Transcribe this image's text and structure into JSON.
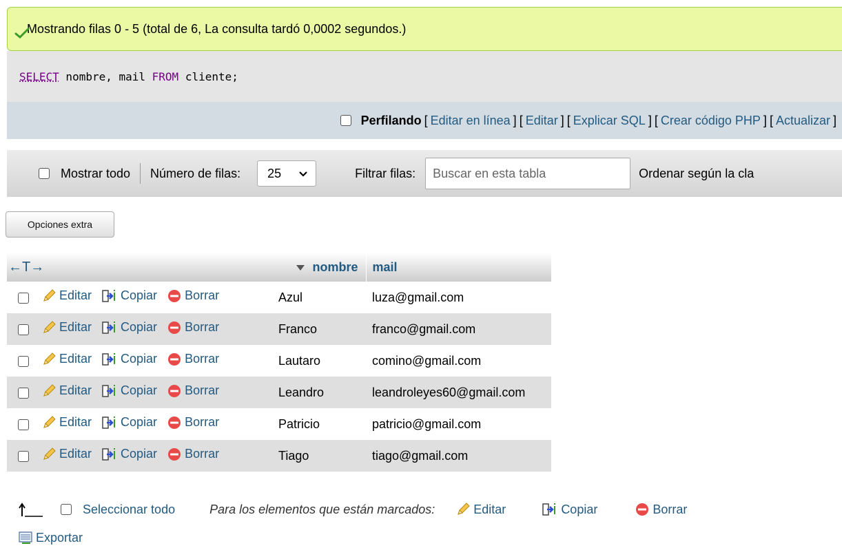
{
  "status": {
    "message": "Mostrando filas 0 - 5 (total de 6, La consulta tardó 0,0002 segundos.)"
  },
  "sql": {
    "select_kw": "SELECT",
    "part1": " nombre, mail ",
    "from_kw": "FROM",
    "part2": " cliente;"
  },
  "tools": {
    "profiling": "Perfilando",
    "open1": "[",
    "edit_inline": "Editar en línea",
    "close1": "]",
    "open2": "[",
    "edit": "Editar",
    "close2": "]",
    "open3": "[",
    "explain": "Explicar SQL",
    "close3": "]",
    "open4": "[",
    "php": "Crear código PHP",
    "close4": "]",
    "open5": "[",
    "refresh": "Actualizar",
    "close5": "]"
  },
  "nav": {
    "show_all": "Mostrar todo",
    "rows_label": "Número de filas:",
    "rows_value": "25",
    "filter_label": "Filtrar filas:",
    "search_placeholder": "Buscar en esta tabla",
    "sort_label": "Ordenar según la cla"
  },
  "extra_options": "Opciones extra",
  "table": {
    "resize_arrows": "←T→",
    "col_nombre": "nombre",
    "col_mail": "mail",
    "action_edit": "Editar",
    "action_copy": "Copiar",
    "action_delete": "Borrar",
    "rows": [
      {
        "nombre": "Azul",
        "mail": "luza@gmail.com"
      },
      {
        "nombre": "Franco",
        "mail": "franco@gmail.com"
      },
      {
        "nombre": "Lautaro",
        "mail": "comino@gmail.com"
      },
      {
        "nombre": "Leandro",
        "mail": "leandroleyes60@gmail.com"
      },
      {
        "nombre": "Patricio",
        "mail": "patricio@gmail.com"
      },
      {
        "nombre": "Tiago",
        "mail": "tiago@gmail.com"
      }
    ]
  },
  "bulk": {
    "select_all": "Seleccionar todo",
    "for_marked": "Para los elementos que están marcados:",
    "edit": "Editar",
    "copy": "Copiar",
    "delete": "Borrar",
    "export": "Exportar"
  },
  "colors": {
    "link": "#235a81",
    "success_bg": "#ebf8a4",
    "even_row": "#dfdfdf"
  }
}
